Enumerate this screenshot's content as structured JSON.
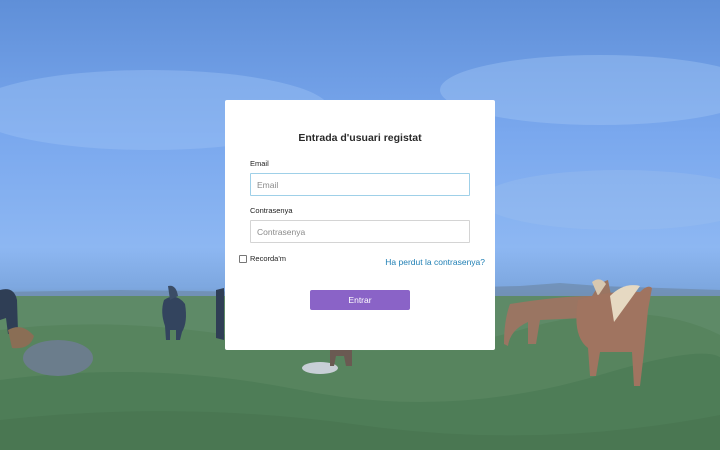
{
  "login": {
    "title": "Entrada d'usuari registat",
    "email_label": "Email",
    "email_placeholder": "Email",
    "email_value": "",
    "password_label": "Contrasenya",
    "password_placeholder": "Contrasenya",
    "password_value": "",
    "remember_label": "Recorda'm",
    "remember_checked": false,
    "forgot_link": "Ha perdut la contrasenya?",
    "submit_label": "Entrar"
  },
  "colors": {
    "submit_bg": "#8a63c7",
    "link": "#1f7fb4",
    "focus_border": "#9fd0e8"
  }
}
